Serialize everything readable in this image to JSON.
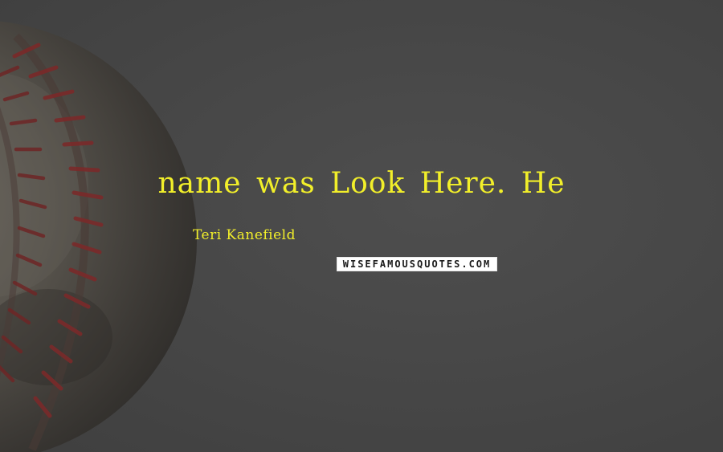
{
  "quote": {
    "text": "name was Look Here. He"
  },
  "author": {
    "name": "Teri Kanefield"
  },
  "watermark": {
    "text": "WISEFAMOUSQUOTES.COM"
  },
  "image": {
    "subject_icon": "baseball-icon"
  },
  "colors": {
    "background": "#474747",
    "text_accent": "#f2ef2a",
    "watermark_bg": "#ffffff",
    "watermark_text": "#1a1a1a",
    "ball_leather": "#5a5650",
    "ball_stitch": "#7a2a2a"
  }
}
